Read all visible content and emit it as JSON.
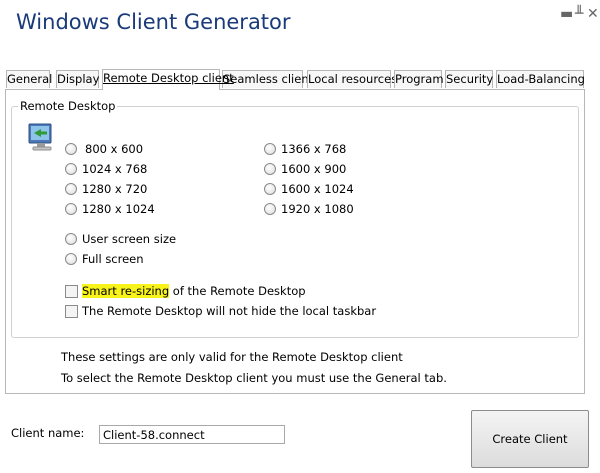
{
  "window": {
    "title": "Windows Client Generator"
  },
  "tabs": [
    {
      "label": "General"
    },
    {
      "label": "Display"
    },
    {
      "label": "Remote Desktop client",
      "active": true
    },
    {
      "label": "Seamless client"
    },
    {
      "label": "Local resources"
    },
    {
      "label": "Program"
    },
    {
      "label": "Security"
    },
    {
      "label": "Load-Balancing"
    }
  ],
  "remote_desktop": {
    "group_label": "Remote Desktop",
    "resolutions_left": [
      "800 x 600",
      "1024 x 768",
      "1280 x 720",
      "1280 x 1024"
    ],
    "resolutions_right": [
      "1366 x 768",
      "1600 x 900",
      "1600 x 1024",
      "1920 x 1080"
    ],
    "user_screen_size": "User screen size",
    "full_screen": "Full screen",
    "smart_resizing_highlight": "Smart re-sizing",
    "smart_resizing_rest": " of the Remote Desktop",
    "taskbar_option": "The Remote Desktop will not hide the local taskbar",
    "note_line1": "These settings are only valid for the Remote Desktop client",
    "note_line2": "To select the Remote Desktop client you must use the General tab."
  },
  "footer": {
    "client_name_label": "Client name:",
    "client_name_value": "Client-58.connect",
    "create_button": "Create Client"
  },
  "icons": {
    "minimize": "minimize-icon",
    "pin": "pin-icon",
    "close": "close-icon",
    "monitor": "monitor-icon"
  }
}
